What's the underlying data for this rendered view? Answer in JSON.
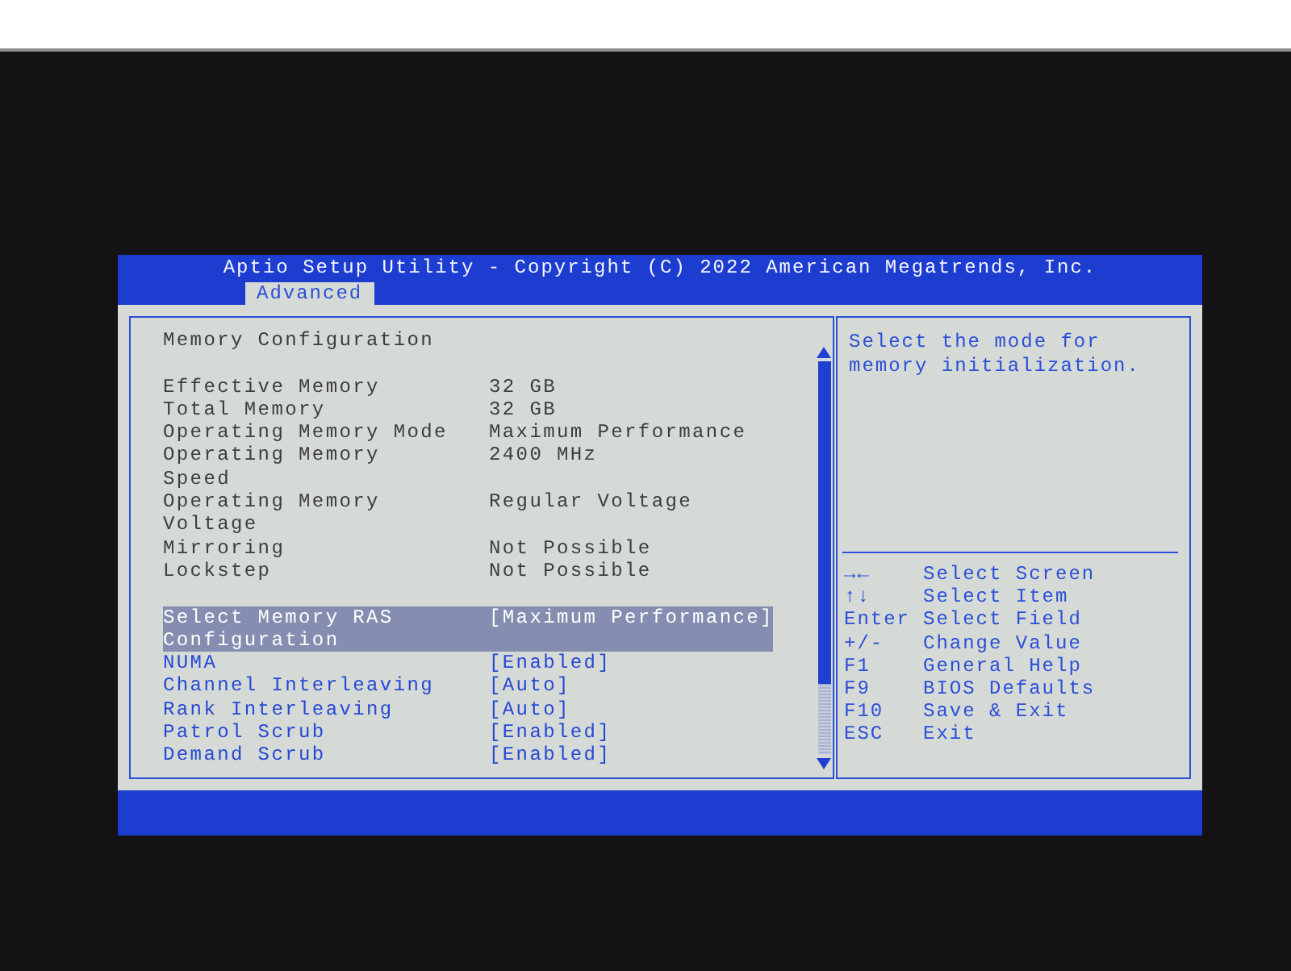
{
  "header": {
    "title": "Aptio Setup Utility - Copyright (C) 2022 American Megatrends, Inc.",
    "tabs": [
      {
        "label": "Advanced",
        "selected": true
      }
    ]
  },
  "settings": {
    "heading": "Memory Configuration",
    "rows": [
      {
        "kind": "info",
        "label": "Effective Memory",
        "value": "32 GB"
      },
      {
        "kind": "info",
        "label": "Total Memory",
        "value": "32 GB"
      },
      {
        "kind": "info",
        "label": "Operating Memory Mode",
        "value": "Maximum Performance"
      },
      {
        "kind": "info",
        "label": "Operating Memory Speed",
        "value": "2400 MHz"
      },
      {
        "kind": "info",
        "label": "Operating Memory Voltage",
        "value": "Regular Voltage"
      },
      {
        "kind": "info",
        "label": "Mirroring",
        "value": "Not Possible"
      },
      {
        "kind": "info",
        "label": "Lockstep",
        "value": "Not Possible"
      },
      {
        "kind": "option",
        "label": "Select Memory RAS Configuration",
        "value": "[Maximum Performance]",
        "selected": true
      },
      {
        "kind": "option",
        "label": "NUMA",
        "value": "[Enabled]",
        "selected": false
      },
      {
        "kind": "option",
        "label": "Channel Interleaving",
        "value": "[Auto]",
        "selected": false
      },
      {
        "kind": "option",
        "label": "Rank Interleaving",
        "value": "[Auto]",
        "selected": false
      },
      {
        "kind": "option",
        "label": "Patrol Scrub",
        "value": "[Enabled]",
        "selected": false
      },
      {
        "kind": "option",
        "label": "Demand Scrub",
        "value": "[Enabled]",
        "selected": false
      }
    ]
  },
  "help": {
    "text": "Select the mode for memory initialization.",
    "keys": [
      {
        "key": "→←",
        "action": "Select Screen"
      },
      {
        "key": "↑↓",
        "action": "Select Item"
      },
      {
        "key": "Enter",
        "action": "Select Field"
      },
      {
        "key": "+/-",
        "action": "Change Value"
      },
      {
        "key": "F1",
        "action": "General Help"
      },
      {
        "key": "F9",
        "action": "BIOS Defaults"
      },
      {
        "key": "F10",
        "action": "Save & Exit"
      },
      {
        "key": "ESC",
        "action": "Exit"
      }
    ]
  }
}
